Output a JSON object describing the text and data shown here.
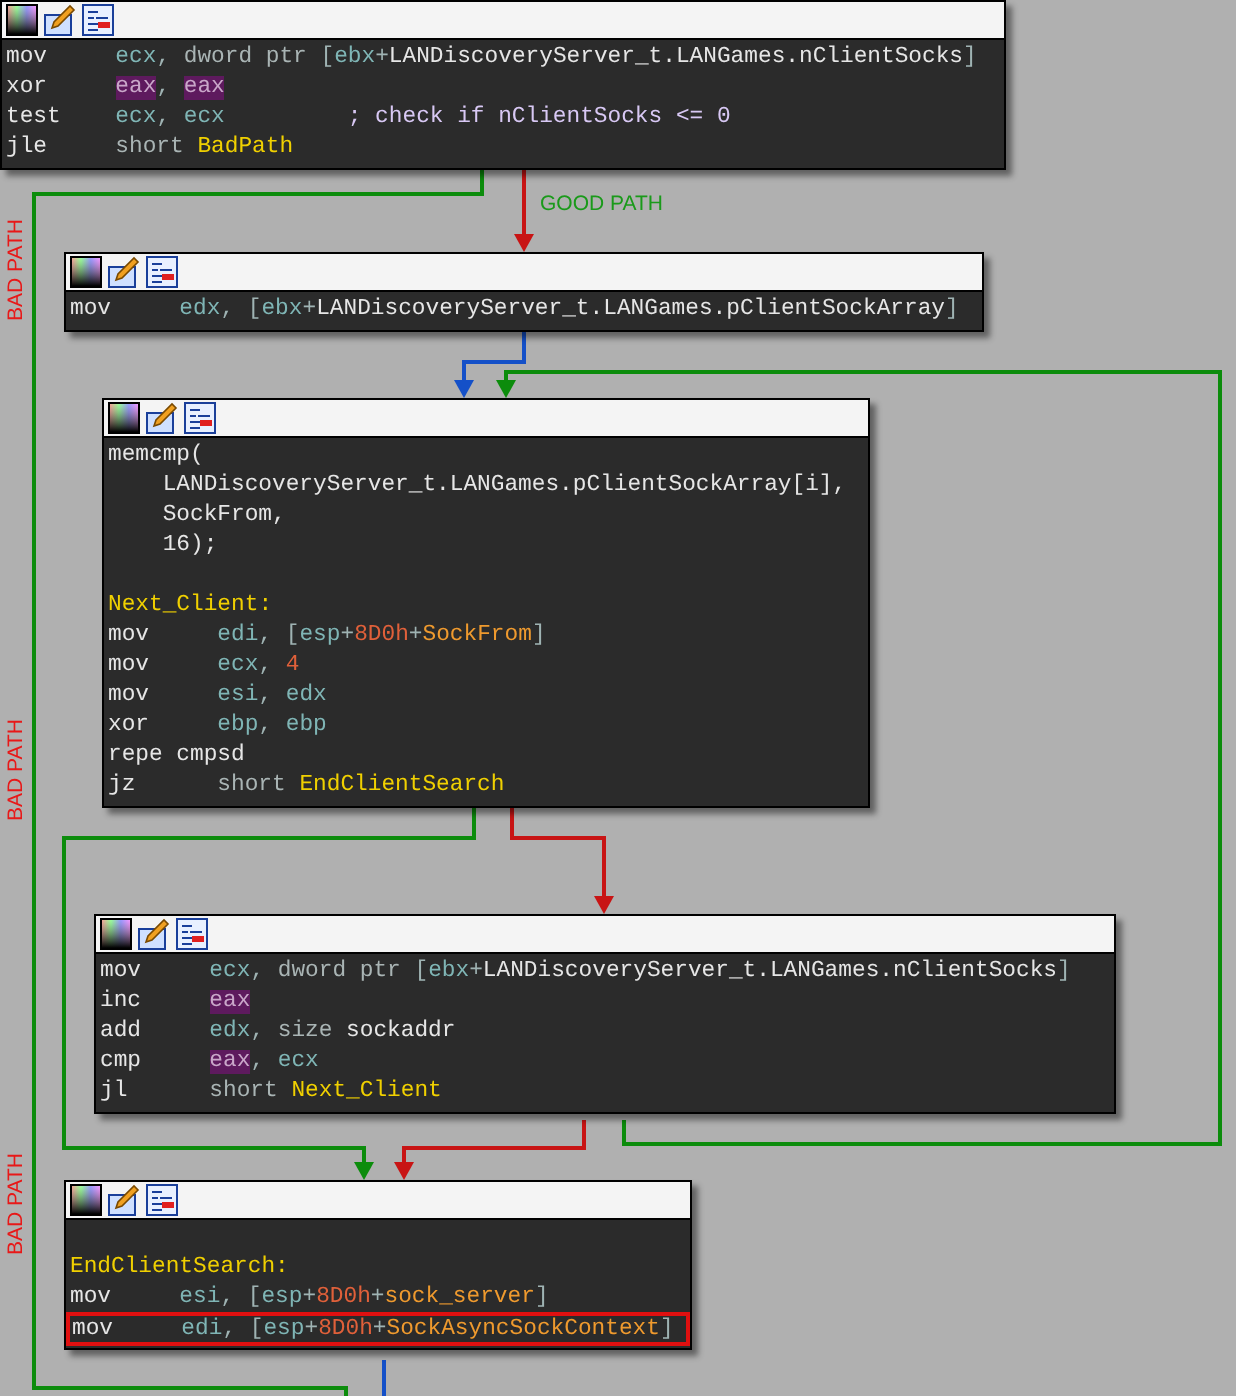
{
  "graph": {
    "nodes": [
      {
        "lines": [
          {
            "kind": "code",
            "highlighted": false,
            "mnemonic": "mov",
            "operands": [
              {
                "text": "ecx",
                "kind": "reg"
              },
              {
                "text": ", ",
                "kind": "punct"
              },
              {
                "text": "dword ptr ",
                "kind": "kw"
              },
              {
                "text": "[",
                "kind": "punct"
              },
              {
                "text": "ebx",
                "kind": "reg"
              },
              {
                "text": "+",
                "kind": "punct"
              },
              {
                "text": "LANDiscoveryServer_t.LANGames.nClientSocks",
                "kind": "name"
              },
              {
                "text": "]",
                "kind": "punct"
              }
            ]
          },
          {
            "kind": "code",
            "highlighted": false,
            "mnemonic": "xor",
            "operands": [
              {
                "text": "eax",
                "kind": "hl"
              },
              {
                "text": ", ",
                "kind": "punct"
              },
              {
                "text": "eax",
                "kind": "hl"
              }
            ]
          },
          {
            "kind": "code",
            "highlighted": false,
            "mnemonic": "test",
            "operands": [
              {
                "text": "ecx",
                "kind": "reg"
              },
              {
                "text": ", ",
                "kind": "punct"
              },
              {
                "text": "ecx",
                "kind": "reg"
              },
              {
                "text": "; check if nClientSocks <= 0",
                "kind": "comment"
              }
            ]
          },
          {
            "kind": "code",
            "highlighted": false,
            "mnemonic": "jle",
            "operands": [
              {
                "text": "short ",
                "kind": "kw"
              },
              {
                "text": "BadPath",
                "kind": "label"
              }
            ]
          }
        ]
      },
      {
        "lines": [
          {
            "kind": "code",
            "highlighted": false,
            "mnemonic": "mov",
            "operands": [
              {
                "text": "edx",
                "kind": "reg"
              },
              {
                "text": ", ",
                "kind": "punct"
              },
              {
                "text": "[",
                "kind": "punct"
              },
              {
                "text": "ebx",
                "kind": "reg"
              },
              {
                "text": "+",
                "kind": "punct"
              },
              {
                "text": "LANDiscoveryServer_t.LANGames.pClientSockArray",
                "kind": "name"
              },
              {
                "text": "]",
                "kind": "punct"
              }
            ]
          }
        ]
      },
      {
        "lines": [
          {
            "kind": "call",
            "highlighted": false,
            "text": "memcmp(",
            "children": [
              {
                "text": "LANDiscoveryServer_t.LANGames.pClientSockArray[i],"
              },
              {
                "text": "SockFrom,"
              },
              {
                "text": "16);"
              }
            ]
          },
          {
            "kind": "blank"
          },
          {
            "kind": "label",
            "highlighted": false,
            "text": "Next_Client:"
          },
          {
            "kind": "code",
            "highlighted": false,
            "mnemonic": "mov",
            "operands": [
              {
                "text": "edi",
                "kind": "reg"
              },
              {
                "text": ", ",
                "kind": "punct"
              },
              {
                "text": "[",
                "kind": "punct"
              },
              {
                "text": "esp",
                "kind": "reg"
              },
              {
                "text": "+",
                "kind": "punct"
              },
              {
                "text": "8D0h",
                "kind": "num"
              },
              {
                "text": "+",
                "kind": "punct"
              },
              {
                "text": "SockFrom",
                "kind": "var"
              },
              {
                "text": "]",
                "kind": "punct"
              }
            ]
          },
          {
            "kind": "code",
            "highlighted": false,
            "mnemonic": "mov",
            "operands": [
              {
                "text": "ecx",
                "kind": "reg"
              },
              {
                "text": ", ",
                "kind": "punct"
              },
              {
                "text": "4",
                "kind": "num"
              }
            ]
          },
          {
            "kind": "code",
            "highlighted": false,
            "mnemonic": "mov",
            "operands": [
              {
                "text": "esi",
                "kind": "reg"
              },
              {
                "text": ", ",
                "kind": "punct"
              },
              {
                "text": "edx",
                "kind": "reg"
              }
            ]
          },
          {
            "kind": "code",
            "highlighted": false,
            "mnemonic": "xor",
            "operands": [
              {
                "text": "ebp",
                "kind": "reg"
              },
              {
                "text": ", ",
                "kind": "punct"
              },
              {
                "text": "ebp",
                "kind": "reg"
              }
            ]
          },
          {
            "kind": "code",
            "highlighted": false,
            "mnemonic": "repe cmpsd"
          },
          {
            "kind": "code",
            "highlighted": false,
            "mnemonic": "jz",
            "operands": [
              {
                "text": "short ",
                "kind": "kw"
              },
              {
                "text": "EndClientSearch",
                "kind": "label"
              }
            ]
          }
        ]
      },
      {
        "lines": [
          {
            "kind": "code",
            "highlighted": false,
            "mnemonic": "mov",
            "operands": [
              {
                "text": "ecx",
                "kind": "reg"
              },
              {
                "text": ", ",
                "kind": "punct"
              },
              {
                "text": "dword ptr ",
                "kind": "kw"
              },
              {
                "text": "[",
                "kind": "punct"
              },
              {
                "text": "ebx",
                "kind": "reg"
              },
              {
                "text": "+",
                "kind": "punct"
              },
              {
                "text": "LANDiscoveryServer_t.LANGames.nClientSocks",
                "kind": "name"
              },
              {
                "text": "]",
                "kind": "punct"
              }
            ]
          },
          {
            "kind": "code",
            "highlighted": false,
            "mnemonic": "inc",
            "operands": [
              {
                "text": "eax",
                "kind": "hl"
              }
            ]
          },
          {
            "kind": "code",
            "highlighted": false,
            "mnemonic": "add",
            "operands": [
              {
                "text": "edx",
                "kind": "reg"
              },
              {
                "text": ", ",
                "kind": "punct"
              },
              {
                "text": "size ",
                "kind": "kw"
              },
              {
                "text": "sockaddr",
                "kind": "name"
              }
            ]
          },
          {
            "kind": "code",
            "highlighted": false,
            "mnemonic": "cmp",
            "operands": [
              {
                "text": "eax",
                "kind": "hl"
              },
              {
                "text": ", ",
                "kind": "punct"
              },
              {
                "text": "ecx",
                "kind": "reg"
              }
            ]
          },
          {
            "kind": "code",
            "highlighted": false,
            "mnemonic": "jl",
            "operands": [
              {
                "text": "short ",
                "kind": "kw"
              },
              {
                "text": "Next_Client",
                "kind": "label"
              }
            ]
          }
        ]
      },
      {
        "lines": [
          {
            "kind": "blank"
          },
          {
            "kind": "label",
            "highlighted": false,
            "text": "EndClientSearch:"
          },
          {
            "kind": "code",
            "highlighted": false,
            "mnemonic": "mov",
            "operands": [
              {
                "text": "esi",
                "kind": "reg"
              },
              {
                "text": ", ",
                "kind": "punct"
              },
              {
                "text": "[",
                "kind": "punct"
              },
              {
                "text": "esp",
                "kind": "reg"
              },
              {
                "text": "+",
                "kind": "punct"
              },
              {
                "text": "8D0h",
                "kind": "num"
              },
              {
                "text": "+",
                "kind": "punct"
              },
              {
                "text": "sock_server",
                "kind": "var"
              },
              {
                "text": "]",
                "kind": "punct"
              }
            ]
          },
          {
            "kind": "code",
            "highlighted": true,
            "mnemonic": "mov",
            "operands": [
              {
                "text": "edi",
                "kind": "reg"
              },
              {
                "text": ", ",
                "kind": "punct"
              },
              {
                "text": "[",
                "kind": "punct"
              },
              {
                "text": "esp",
                "kind": "reg"
              },
              {
                "text": "+",
                "kind": "punct"
              },
              {
                "text": "8D0h",
                "kind": "num"
              },
              {
                "text": "+",
                "kind": "punct"
              },
              {
                "text": "SockAsyncSockContext",
                "kind": "var"
              },
              {
                "text": "]",
                "kind": "punct"
              }
            ]
          }
        ]
      }
    ],
    "edges": [
      {
        "kind": "true"
      },
      {
        "kind": "false"
      },
      {
        "kind": "flow"
      },
      {
        "kind": "true"
      },
      {
        "kind": "true"
      },
      {
        "kind": "false"
      },
      {
        "kind": "false"
      },
      {
        "kind": "flow"
      }
    ],
    "edge_labels": [
      {
        "text": "GOOD PATH",
        "kind": "good"
      },
      {
        "text": "BAD PATH",
        "kind": "bad"
      },
      {
        "text": "BAD PATH",
        "kind": "bad"
      },
      {
        "text": "BAD PATH",
        "kind": "bad"
      }
    ]
  }
}
